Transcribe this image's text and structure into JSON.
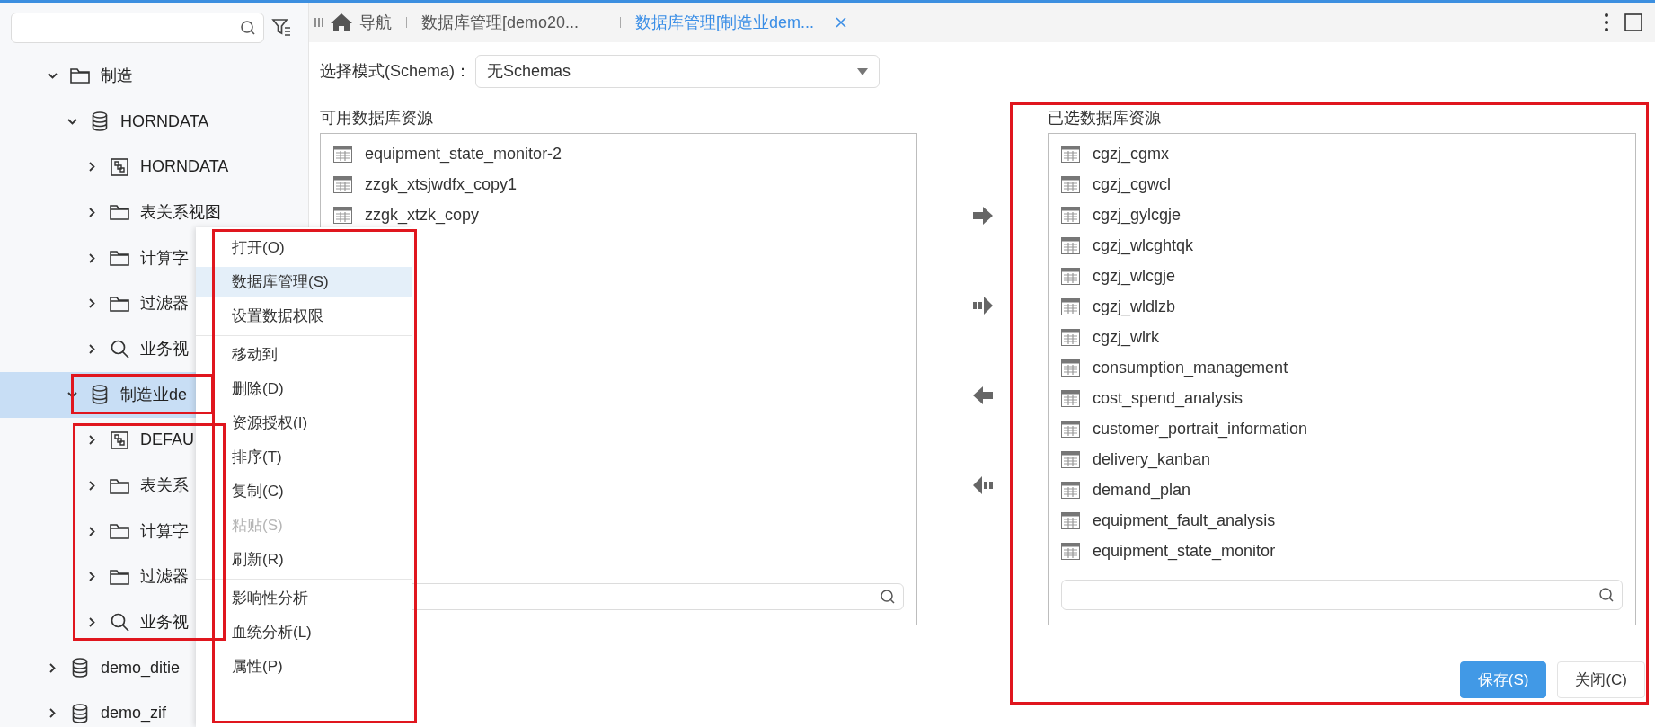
{
  "tabs": [
    {
      "label": "导航",
      "kind": "home",
      "selected": false
    },
    {
      "label": "数据库管理[demo20...",
      "kind": "page",
      "selected": false
    },
    {
      "label": "数据库管理[制造业dem...",
      "kind": "page",
      "selected": true
    }
  ],
  "tree": [
    {
      "label": "制造",
      "kind": "folder",
      "expanded": true,
      "selected": false,
      "children": [
        {
          "label": "HORNDATA",
          "kind": "database",
          "expanded": true,
          "selected": false,
          "children": [
            {
              "label": "HORNDATA",
              "kind": "schema",
              "expanded": false,
              "selected": false
            },
            {
              "label": "表关系视图",
              "kind": "folder",
              "expanded": false,
              "selected": false
            },
            {
              "label": "计算字",
              "kind": "folder",
              "expanded": false,
              "selected": false
            },
            {
              "label": "过滤器",
              "kind": "folder",
              "expanded": false,
              "selected": false
            },
            {
              "label": "业务视",
              "kind": "view",
              "expanded": false,
              "selected": false
            }
          ]
        },
        {
          "label": "制造业de",
          "kind": "database",
          "expanded": true,
          "selected": true,
          "children": [
            {
              "label": "DEFAU",
              "kind": "schema",
              "expanded": false,
              "selected": false
            },
            {
              "label": "表关系",
              "kind": "folder",
              "expanded": false,
              "selected": false
            },
            {
              "label": "计算字",
              "kind": "folder",
              "expanded": false,
              "selected": false
            },
            {
              "label": "过滤器",
              "kind": "folder",
              "expanded": false,
              "selected": false
            },
            {
              "label": "业务视",
              "kind": "view",
              "expanded": false,
              "selected": false
            }
          ]
        }
      ]
    },
    {
      "label": "demo_ditie",
      "kind": "database",
      "expanded": false,
      "selected": false
    },
    {
      "label": "demo_zif",
      "kind": "database",
      "expanded": false,
      "selected": false
    }
  ],
  "context_menu": {
    "items": [
      {
        "label": "打开(O)",
        "highlighted": false,
        "disabled": false,
        "separator_before": false
      },
      {
        "label": "数据库管理(S)",
        "highlighted": true,
        "disabled": false,
        "separator_before": false
      },
      {
        "label": "设置数据权限",
        "highlighted": false,
        "disabled": false,
        "separator_before": false
      },
      {
        "label": "移动到",
        "highlighted": false,
        "disabled": false,
        "separator_before": true
      },
      {
        "label": "删除(D)",
        "highlighted": false,
        "disabled": false,
        "separator_before": false
      },
      {
        "label": "资源授权(I)",
        "highlighted": false,
        "disabled": false,
        "separator_before": false
      },
      {
        "label": "排序(T)",
        "highlighted": false,
        "disabled": false,
        "separator_before": false
      },
      {
        "label": "复制(C)",
        "highlighted": false,
        "disabled": false,
        "separator_before": false
      },
      {
        "label": "粘贴(S)",
        "highlighted": false,
        "disabled": true,
        "separator_before": false
      },
      {
        "label": "刷新(R)",
        "highlighted": false,
        "disabled": false,
        "separator_before": false
      },
      {
        "label": "影响性分析",
        "highlighted": false,
        "disabled": false,
        "separator_before": true
      },
      {
        "label": "血统分析(L)",
        "highlighted": false,
        "disabled": false,
        "separator_before": false
      },
      {
        "label": "属性(P)",
        "highlighted": false,
        "disabled": false,
        "separator_before": false
      }
    ]
  },
  "schema": {
    "label": "选择模式(Schema)：",
    "value": "无Schemas"
  },
  "available": {
    "title": "可用数据库资源",
    "items": [
      "equipment_state_monitor-2",
      "zzgk_xtsjwdfx_copy1",
      "zzgk_xtzk_copy"
    ]
  },
  "chosen": {
    "title": "已选数据库资源",
    "items": [
      "cgzj_cgmx",
      "cgzj_cgwcl",
      "cgzj_gylcgje",
      "cgzj_wlcghtqk",
      "cgzj_wlcgje",
      "cgzj_wldlzb",
      "cgzj_wlrk",
      "consumption_management",
      "cost_spend_analysis",
      "customer_portrait_information",
      "delivery_kanban",
      "demand_plan",
      "equipment_fault_analysis",
      "equipment_state_monitor"
    ]
  },
  "buttons": [
    {
      "label": "保存(S)",
      "kind": "primary"
    },
    {
      "label": "关闭(C)",
      "kind": "default"
    }
  ]
}
